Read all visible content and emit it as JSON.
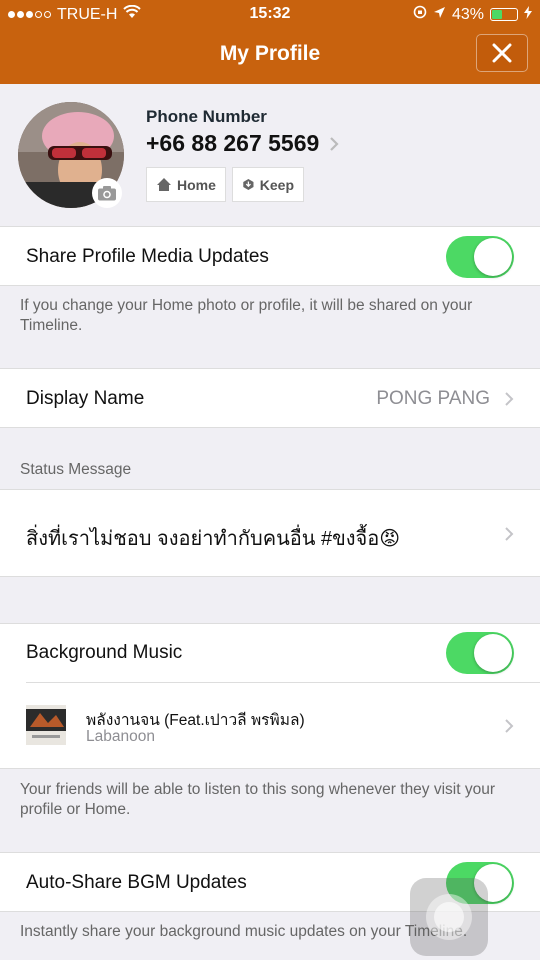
{
  "status_bar": {
    "carrier": "TRUE-H",
    "time": "15:32",
    "battery": "43%",
    "battery_level": 0.43,
    "signal_bars_filled": 3,
    "signal_bars_total": 5
  },
  "header": {
    "title": "My Profile",
    "color": "#c8620e"
  },
  "profile": {
    "phone_label": "Phone Number",
    "phone_number": "+66 88 267 5569",
    "home_label": "Home",
    "keep_label": "Keep"
  },
  "share_media": {
    "label": "Share Profile Media Updates",
    "enabled": true,
    "note": "If you change your Home photo or profile, it will be shared on your Timeline."
  },
  "display_name": {
    "label": "Display Name",
    "value": "PONG PANG"
  },
  "status_message": {
    "section_label": "Status Message",
    "text": "สิ่งที่เราไม่ชอบ จงอย่าทำกับคนอื่น #ขงจื้อ😡"
  },
  "background_music": {
    "label": "Background Music",
    "enabled": true,
    "song_title": "พลังงานจน (Feat.เปาวลี พรพิมล)",
    "artist": "Labanoon",
    "note": "Your friends will be able to listen to this song whenever they visit your profile or Home."
  },
  "auto_share_bgm": {
    "label": "Auto-Share BGM Updates",
    "enabled": true,
    "note": "Instantly share your background music updates on your Timeline."
  },
  "colors": {
    "accent": "#c8620e",
    "toggle_on": "#4cd964",
    "background": "#f0eff4"
  }
}
